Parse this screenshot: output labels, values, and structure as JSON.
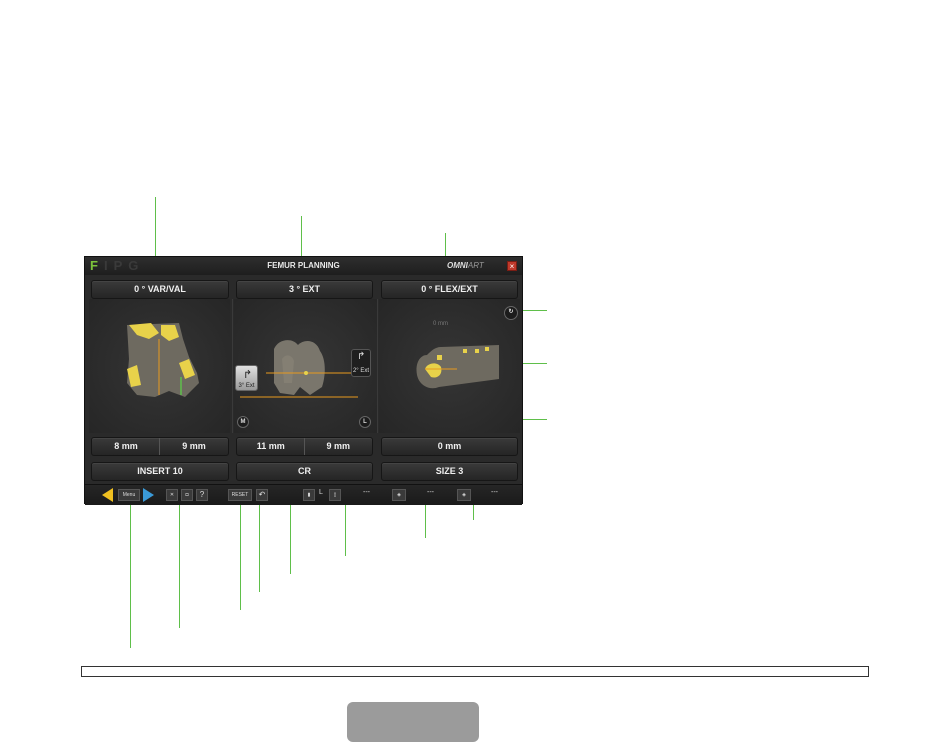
{
  "window": {
    "logo": "FIPG",
    "logo_first": "F",
    "logo_rest": "IPG",
    "title": "FEMUR PLANNING",
    "brand": "OMNI",
    "brand_suffix": "ART",
    "close": "×"
  },
  "headers": {
    "varval": "0 ° VAR/VAL",
    "ext": "3 ° EXT",
    "flexext": "0 ° FLEX/EXT"
  },
  "view": {
    "rotate_left_label": "3° Ext",
    "rotate_right_label": "2° Ext",
    "m_label": "M",
    "l_label": "L",
    "gap_label": "0 mm"
  },
  "measurements": {
    "left_a": "8 mm",
    "left_b": "9 mm",
    "mid_a": "11 mm",
    "mid_b": "9 mm",
    "right": "0 mm"
  },
  "bottom": {
    "insert": "INSERT 10",
    "type": "CR",
    "size": "SIZE 3"
  },
  "toolbar": {
    "menu": "Menu",
    "reset": "RESET",
    "help": "?",
    "l_label": "L",
    "dash1": "---",
    "dash2": "---",
    "dash3": "---"
  },
  "colors": {
    "callout": "#5fbf4a",
    "bone_highlight": "#e8d24a",
    "axis_line": "#e89a1e",
    "nav_arrow_left": "#f0c020",
    "nav_arrow_right": "#3a9ad8"
  }
}
